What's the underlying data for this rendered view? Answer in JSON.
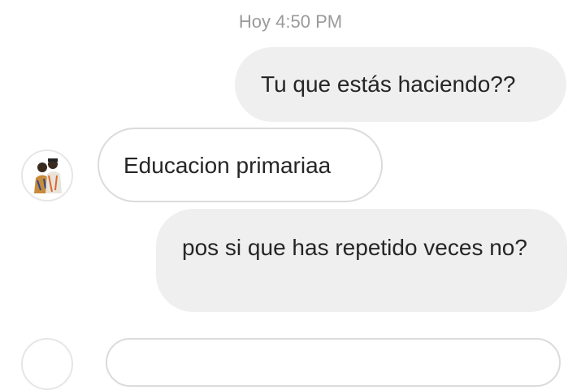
{
  "timestamp": "Hoy 4:50 PM",
  "messages": [
    {
      "direction": "outgoing",
      "text": "Tu que estás haciendo??"
    },
    {
      "direction": "incoming",
      "text": "Educacion primariaa"
    },
    {
      "direction": "outgoing",
      "text": "pos si que has repetido veces no?"
    }
  ],
  "colors": {
    "outgoing_bubble": "#efefef",
    "incoming_border": "#dbdbdb",
    "text": "#262626",
    "timestamp": "#9a9a9a"
  },
  "icons": {
    "contact_avatar": "avatar"
  }
}
